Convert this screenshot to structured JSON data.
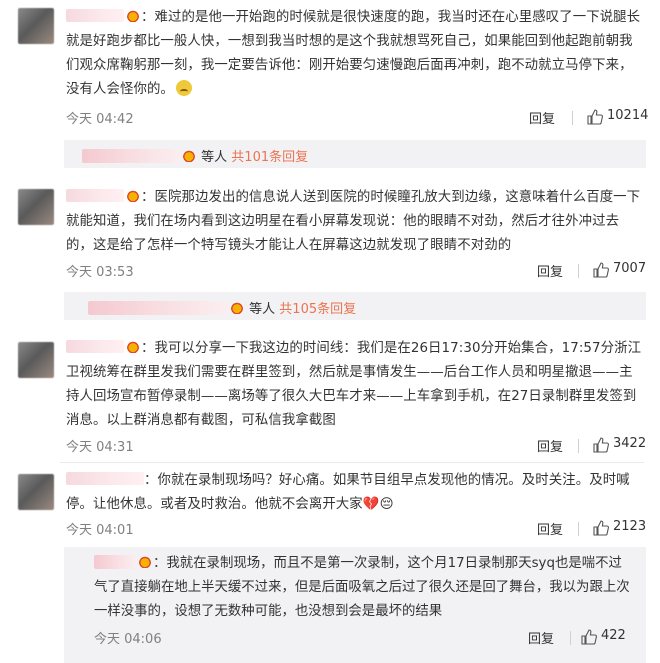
{
  "comments": [
    {
      "text": "难过的是他一开始跑的时候就是很快速度的跑，我当时还在心里感叹了一下说腿长就是好跑步都比一般人快，一想到我当时想的是这个我就想骂死自己，如果能回到他起跑前朝我们观众席鞠躬那一刻，我一定要告诉他：刚开始要匀速慢跑后面再冲刺，跑不动就立马停下来，没有人会怪你的。",
      "time": "今天 04:42",
      "reply_label": "回复",
      "likes": "10214"
    },
    {
      "text": "医院那边发出的信息说人送到医院的时候瞳孔放大到边缘，这意味着什么百度一下就能知道，我们在场内看到这边明星在看小屏幕发现说：他的眼睛不对劲，然后才往外冲过去的，这是给了怎样一个特写镜头才能让人在屏幕这边就发现了眼睛不对劲的",
      "time": "今天 03:53",
      "reply_label": "回复",
      "likes": "7007"
    },
    {
      "text": "我可以分享一下我这边的时间线：我们是在26日17:30分开始集合，17:57分浙江卫视统筹在群里发我们需要在群里签到，然后就是事情发生——后台工作人员和明星撤退——主持人回场宣布暂停录制——离场等了很久大巴车才来——上车拿到手机，在27日录制群里发签到消息。以上群消息都有截图，可私信我拿截图",
      "time": "今天 04:31",
      "reply_label": "回复",
      "likes": "3422"
    },
    {
      "text": "你就在录制现场吗？好心痛。如果节目组早点发现他的情况。及时关注。及时喊停。让他休息。或者及时救治。他就不会离开大家💔😔",
      "time": "今天 04:01",
      "reply_label": "回复",
      "likes": "2123"
    }
  ],
  "reply_summaries": [
    {
      "prefix": "等人",
      "link": "共101条回复"
    },
    {
      "prefix": "等人",
      "link": "共105条回复"
    }
  ],
  "nested_reply": {
    "text": "我就在录制现场，而且不是第一次录制，这个月17日录制那天syq也是喘不过气了直接躺在地上半天缓不过来，但是后面吸氧之后过了很久还是回了舞台，我以为跟上次一样没事的，设想了无数种可能，也没想到会是最坏的结果",
    "time": "今天 04:06",
    "reply_label": "回复",
    "likes": "422"
  },
  "colors": {
    "link": "#eb7350",
    "meta": "#808080",
    "text": "#333333",
    "reply_bg": "#f2f2f5"
  }
}
